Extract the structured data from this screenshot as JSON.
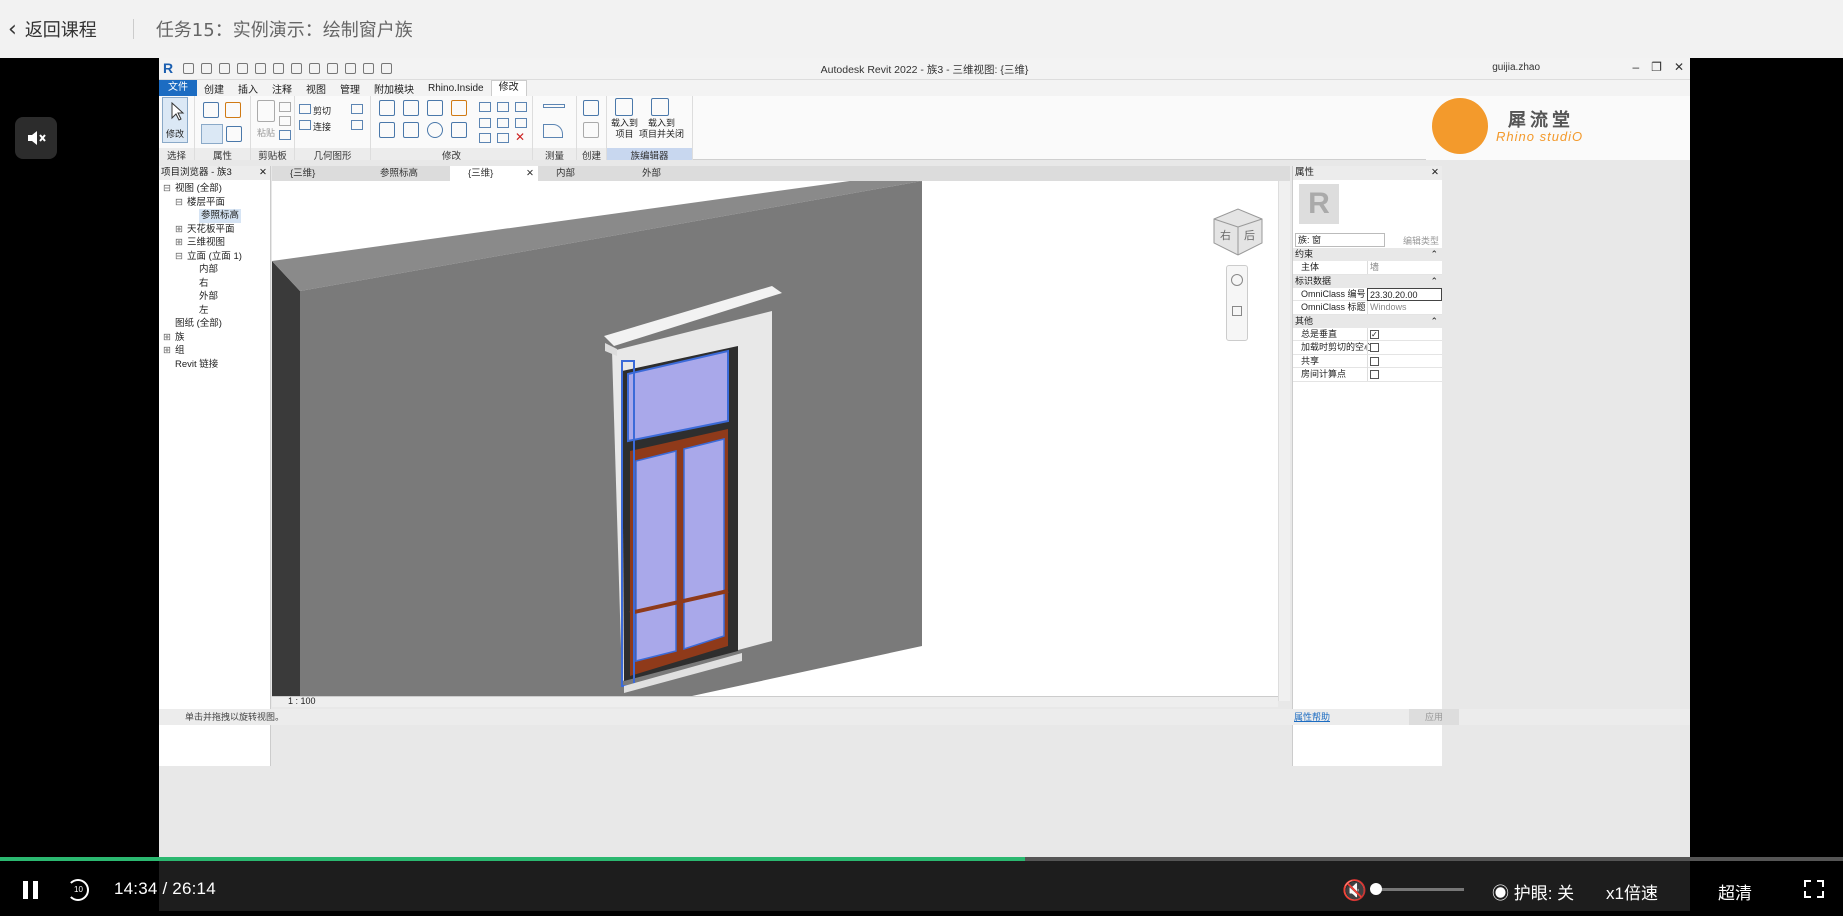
{
  "topbar": {
    "back_label": "返回课程",
    "title": "任务15：实例演示：绘制窗户族"
  },
  "revit": {
    "app_title": "Autodesk Revit 2022 - 族3 - 三维视图: {三维}",
    "user": "guijia.zhao",
    "tabs": [
      "文件",
      "创建",
      "插入",
      "注释",
      "视图",
      "管理",
      "附加模块",
      "Rhino.Inside",
      "修改"
    ],
    "ribbon": {
      "panels": [
        "选择",
        "属性",
        "剪贴板",
        "几何图形",
        "修改",
        "测量",
        "创建",
        "族编辑器"
      ],
      "modify_label": "修改",
      "paste_label": "粘贴",
      "cut_label": "剪切",
      "join_label": "连接",
      "load_into_project": "载入到\n项目",
      "load_into_project_close": "载入到\n项目并关闭"
    },
    "brand": {
      "cn": "犀流堂",
      "en": "Rhino studiO"
    },
    "project_browser": {
      "title": "项目浏览器 - 族3",
      "items": [
        {
          "label": "视图 (全部)",
          "indent": 0,
          "exp": "⊟"
        },
        {
          "label": "楼层平面",
          "indent": 1,
          "exp": "⊟"
        },
        {
          "label": "参照标高",
          "indent": 2,
          "exp": "",
          "selected": true
        },
        {
          "label": "天花板平面",
          "indent": 1,
          "exp": "⊞"
        },
        {
          "label": "三维视图",
          "indent": 1,
          "exp": "⊞"
        },
        {
          "label": "立面 (立面 1)",
          "indent": 1,
          "exp": "⊟"
        },
        {
          "label": "内部",
          "indent": 2,
          "exp": ""
        },
        {
          "label": "右",
          "indent": 2,
          "exp": ""
        },
        {
          "label": "外部",
          "indent": 2,
          "exp": ""
        },
        {
          "label": "左",
          "indent": 2,
          "exp": ""
        },
        {
          "label": "图纸 (全部)",
          "indent": 0,
          "exp": ""
        },
        {
          "label": "族",
          "indent": 0,
          "exp": "⊞"
        },
        {
          "label": "组",
          "indent": 0,
          "exp": "⊞"
        },
        {
          "label": "Revit 链接",
          "indent": 0,
          "exp": ""
        }
      ]
    },
    "view_tabs": [
      "{三维}",
      "参照标高",
      "{三维}",
      "内部",
      "外部"
    ],
    "active_view_tab": 2,
    "viewcube": {
      "right": "右",
      "back": "后"
    },
    "properties": {
      "title": "属性",
      "type_selector": "族: 窗",
      "edit_type": "编辑类型",
      "groups": [
        {
          "name": "约束",
          "rows": [
            {
              "k": "主体",
              "v": "墙"
            }
          ]
        },
        {
          "name": "标识数据",
          "rows": [
            {
              "k": "OmniClass 编号",
              "v": "23.30.20.00",
              "input": true
            },
            {
              "k": "OmniClass 标题",
              "v": "Windows"
            }
          ]
        },
        {
          "name": "其他",
          "rows": [
            {
              "k": "总是垂直",
              "check": true
            },
            {
              "k": "加载时剪切的空心",
              "check": false
            },
            {
              "k": "共享",
              "check": false
            },
            {
              "k": "房间计算点",
              "check": false
            }
          ]
        }
      ],
      "help": "属性帮助",
      "apply": "应用"
    },
    "statusbar": {
      "scale": "1 : 100",
      "hint": "单击并拖拽以旋转视图。"
    }
  },
  "player": {
    "current": "14:34",
    "total": "26:14",
    "time_text": "14:34 / 26:14",
    "progress": 0.556,
    "eye_label": "护眼: 关",
    "speed_label": "x1倍速",
    "quality_label": "超清",
    "volume": 0.0
  }
}
